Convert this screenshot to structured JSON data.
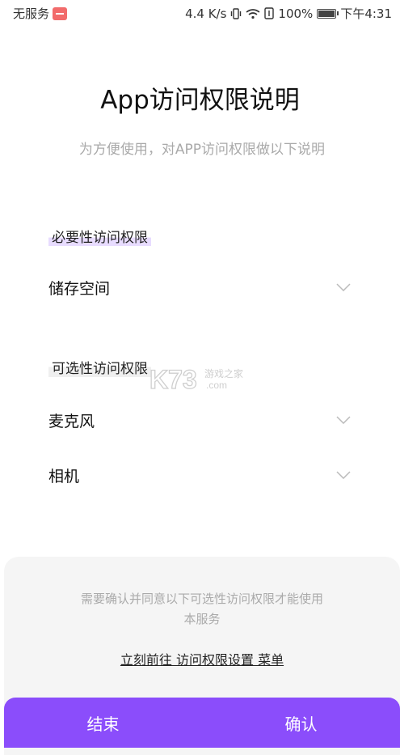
{
  "status_bar": {
    "carrier": "无服务",
    "speed": "4.4 K/s",
    "battery_percent": "100%",
    "time": "下午4:31",
    "icons": [
      "sim-error-icon",
      "vibrate-icon",
      "wifi-icon",
      "nfc-icon",
      "battery-icon"
    ]
  },
  "header": {
    "title": "App访问权限说明",
    "subtitle": "为方便使用，对APP访问权限做以下说明"
  },
  "sections": {
    "required": {
      "label": "必要性访问权限",
      "items": [
        {
          "label": "储存空间",
          "expanded": false
        }
      ]
    },
    "optional": {
      "label": "可选性访问权限",
      "items": [
        {
          "label": "麦克风",
          "expanded": false
        },
        {
          "label": "相机",
          "expanded": false
        }
      ]
    }
  },
  "watermark": {
    "brand": "K73",
    "tagline": "游戏之家",
    "domain": ".com"
  },
  "bottom_panel": {
    "notice": "需要确认并同意以下可选性访问权限才能使用本服务",
    "settings_link": "立刻前往 访问权限设置 菜单",
    "cancel_label": "结束",
    "confirm_label": "确认"
  },
  "colors": {
    "accent": "#8b4dfb",
    "highlight": "#e8dcff",
    "panel_bg": "#f5f5f5",
    "muted_text": "#aaaaaa"
  }
}
